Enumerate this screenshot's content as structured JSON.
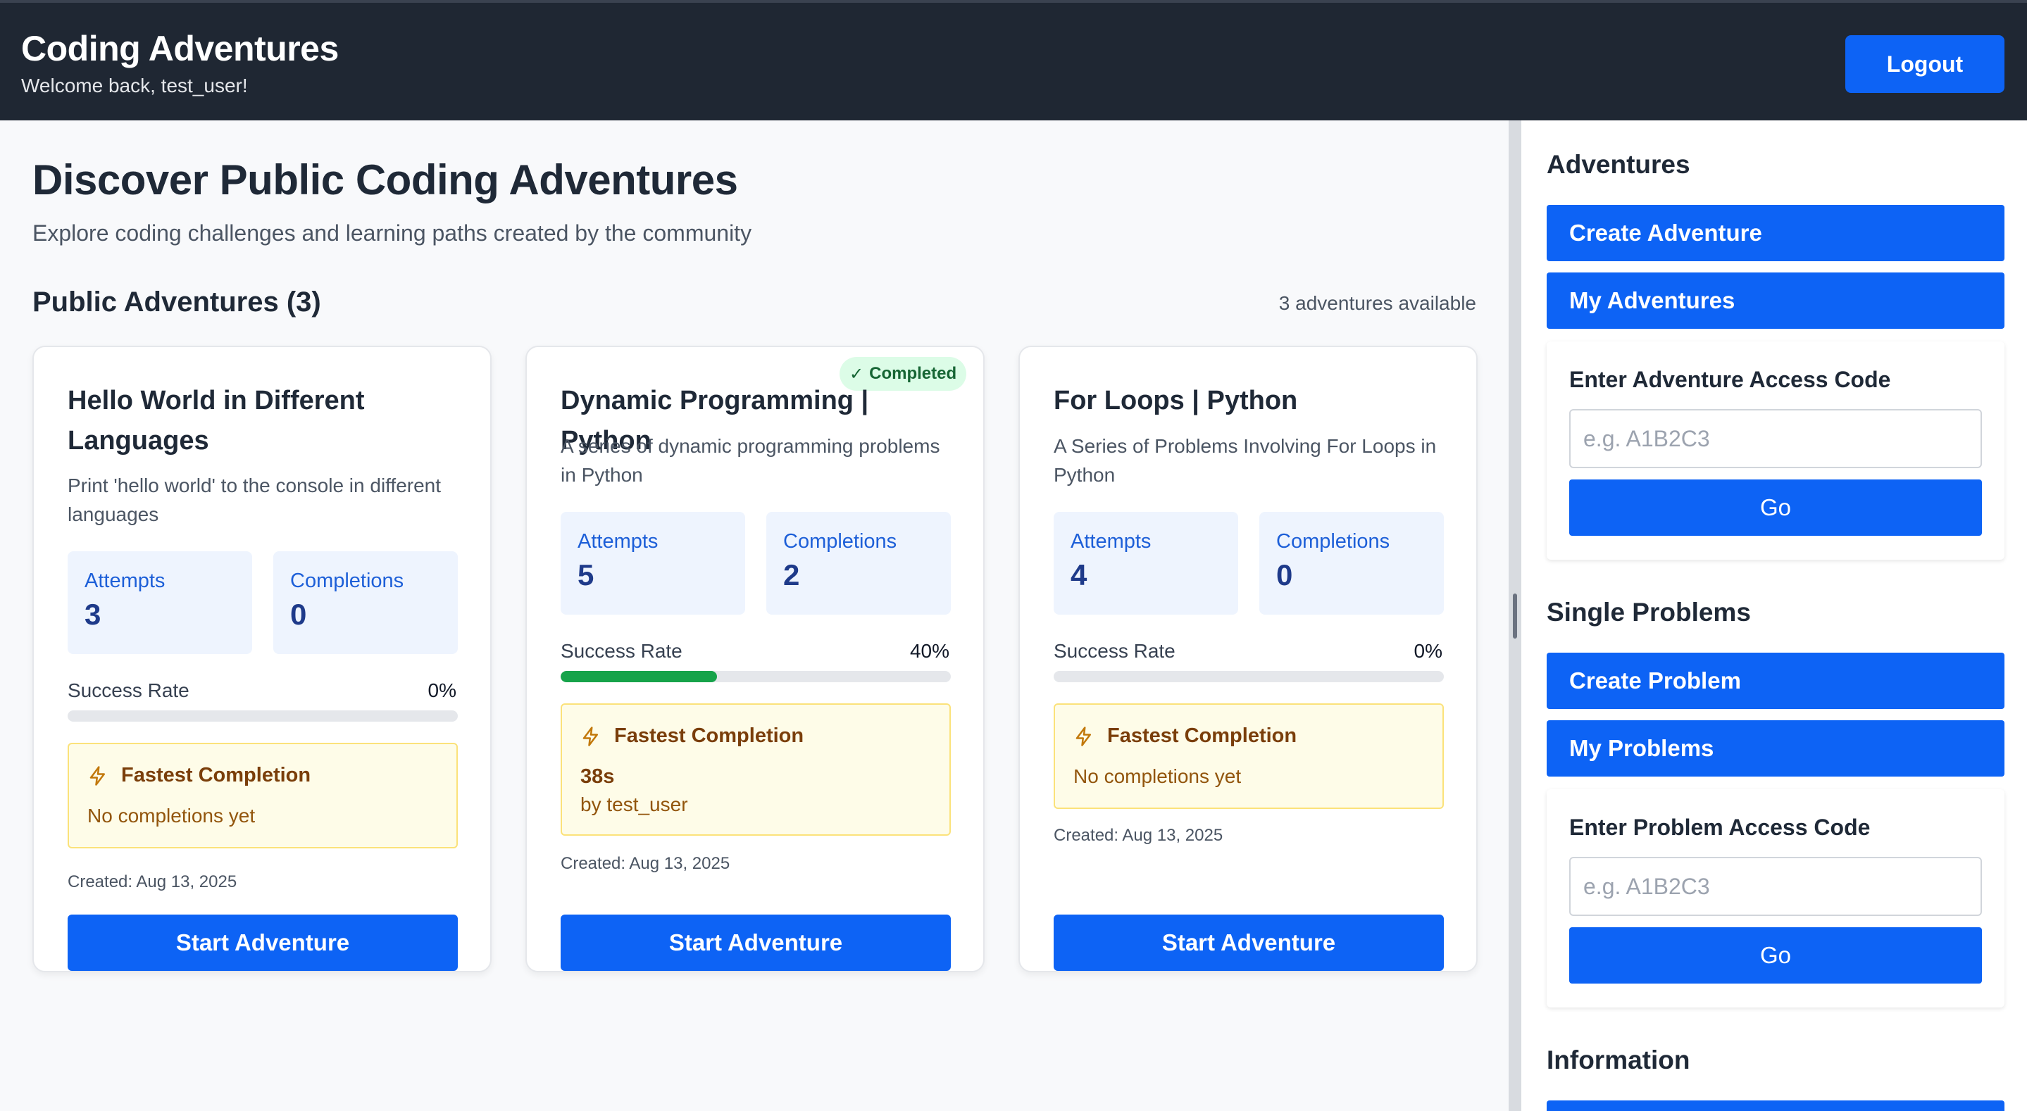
{
  "header": {
    "app_title": "Coding Adventures",
    "welcome": "Welcome back, test_user!",
    "logout_label": "Logout"
  },
  "main": {
    "title": "Discover Public Coding Adventures",
    "subtitle": "Explore coding challenges and learning paths created by the community",
    "section_title": "Public Adventures (3)",
    "available": "3 adventures available",
    "cards": [
      {
        "title": "Hello World in Different Languages",
        "description": "Print 'hello world' to the console in different languages",
        "attempts_label": "Attempts",
        "attempts": "3",
        "completions_label": "Completions",
        "completions": "0",
        "success_label": "Success Rate",
        "success_rate": "0%",
        "success_fraction": 0,
        "fastest_label": "Fastest Completion",
        "fastest_note": "No completions yet",
        "created": "Created: Aug 13, 2025",
        "start_label": "Start Adventure"
      },
      {
        "title": "Dynamic Programming | Python",
        "badge": "Completed",
        "badge_icon": "✓",
        "description": "A series of dynamic programming problems in Python",
        "attempts_label": "Attempts",
        "attempts": "5",
        "completions_label": "Completions",
        "completions": "2",
        "success_label": "Success Rate",
        "success_rate": "40%",
        "success_fraction": 0.4,
        "fastest_label": "Fastest Completion",
        "fastest_time": "38s",
        "fastest_by": "by test_user",
        "created": "Created: Aug 13, 2025",
        "start_label": "Start Adventure"
      },
      {
        "title": "For Loops | Python",
        "description": "A Series of Problems Involving For Loops in Python",
        "attempts_label": "Attempts",
        "attempts": "4",
        "completions_label": "Completions",
        "completions": "0",
        "success_label": "Success Rate",
        "success_rate": "0%",
        "success_fraction": 0,
        "fastest_label": "Fastest Completion",
        "fastest_note": "No completions yet",
        "created": "Created: Aug 13, 2025",
        "start_label": "Start Adventure"
      }
    ]
  },
  "sidebar": {
    "adventures_heading": "Adventures",
    "create_adventure": "Create Adventure",
    "my_adventures": "My Adventures",
    "adventure_code_label": "Enter Adventure Access Code",
    "adventure_code_placeholder": "e.g. A1B2C3",
    "adventure_go": "Go",
    "single_problems_heading": "Single Problems",
    "create_problem": "Create Problem",
    "my_problems": "My Problems",
    "problem_code_label": "Enter Problem Access Code",
    "problem_code_placeholder": "e.g. A1B2C3",
    "problem_go": "Go",
    "information_heading": "Information"
  },
  "colors": {
    "header_bg": "#1f2733",
    "primary": "#0d63f5",
    "success": "#16a34a",
    "stat_bg": "#eef4fe",
    "fastest_bg": "#fefce8"
  },
  "icons": {
    "fastest": "bolt-icon",
    "completed": "check-icon"
  }
}
